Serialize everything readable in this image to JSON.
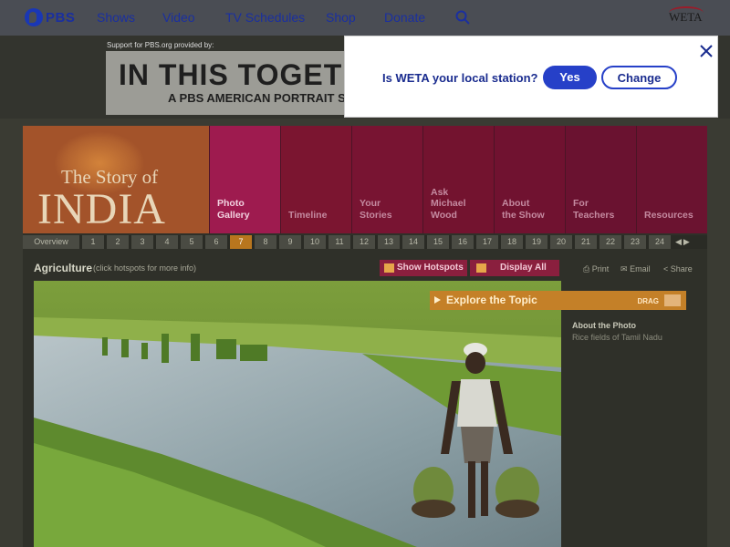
{
  "pbs_nav": {
    "logo_text": "PBS",
    "items": [
      "Shows",
      "Video",
      "TV Schedules",
      "Shop",
      "Donate"
    ],
    "search_icon": "search-icon",
    "station_logo_text": "WETA"
  },
  "sponsor": {
    "label": "Support for PBS.org provided by:",
    "ad_headline": "IN THIS TOGETHER",
    "ad_subline": "A PBS AMERICAN PORTRAIT S"
  },
  "station_popup": {
    "question": "Is WETA your local station?",
    "yes_label": "Yes",
    "change_label": "Change",
    "close_icon": "close-icon"
  },
  "site": {
    "banner": {
      "line1": "The Story of",
      "line2": "INDIA"
    },
    "topnav": [
      [
        "Photo",
        "Gallery"
      ],
      [
        "Timeline"
      ],
      [
        "Your",
        "Stories"
      ],
      [
        "Ask",
        "Michael",
        "Wood"
      ],
      [
        "About",
        "the Show"
      ],
      [
        "For",
        "Teachers"
      ],
      [
        "Resources"
      ]
    ],
    "active_topnav_index": 0,
    "numbar": {
      "overview": "Overview",
      "numbers": [
        "1",
        "2",
        "3",
        "4",
        "5",
        "6",
        "7",
        "8",
        "9",
        "10",
        "11",
        "12",
        "13",
        "14",
        "15",
        "16",
        "17",
        "18",
        "19",
        "20",
        "21",
        "22",
        "23",
        "24"
      ],
      "active": "7",
      "prev_icon": "triangle-left-icon",
      "next_icon": "triangle-right-icon"
    },
    "section_title": "Agriculture",
    "hint": "(click hotspots for more info)",
    "show_hotspots": "Show Hotspots",
    "display_all": "Display All",
    "print": "Print",
    "email": "Email",
    "share": "Share",
    "explore": {
      "label": "Explore the Topic",
      "drag": "DRAG"
    },
    "about_photo": {
      "label": "About the Photo",
      "caption": "Rice fields of Tamil Nadu"
    }
  },
  "colors": {
    "pbs_blue": "#1a2fa0",
    "site_magenta": "#8a1f3e",
    "accent_orange": "#b8761e"
  }
}
